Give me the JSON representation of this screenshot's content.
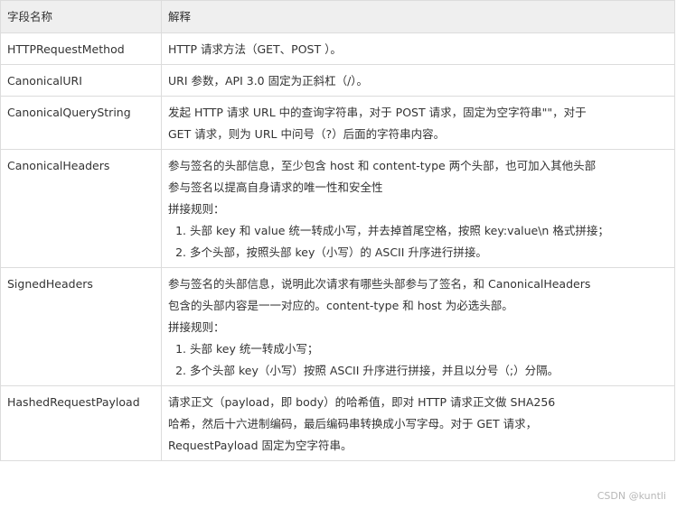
{
  "table": {
    "headers": [
      "字段名称",
      "解释"
    ],
    "rows": [
      {
        "name": "HTTPRequestMethod",
        "desc": [
          "HTTP 请求方法（GET、POST ）。"
        ]
      },
      {
        "name": "CanonicalURI",
        "desc": [
          "URI 参数，API 3.0 固定为正斜杠（/）。"
        ]
      },
      {
        "name": "CanonicalQueryString",
        "desc": [
          "发起 HTTP 请求 URL 中的查询字符串，对于 POST 请求，固定为空字符串\"\"，对于",
          "GET 请求，则为 URL 中问号（?）后面的字符串内容。"
        ]
      },
      {
        "name": "CanonicalHeaders",
        "desc": [
          "参与签名的头部信息，至少包含 host 和 content-type 两个头部，也可加入其他头部",
          "参与签名以提高自身请求的唯一性和安全性"
        ],
        "rule_title": "拼接规则：",
        "rules": [
          "头部 key 和 value 统一转成小写，并去掉首尾空格，按照 key:value\\n 格式拼接；",
          "多个头部，按照头部 key（小写）的 ASCII 升序进行拼接。"
        ]
      },
      {
        "name": "SignedHeaders",
        "desc": [
          "参与签名的头部信息，说明此次请求有哪些头部参与了签名，和 CanonicalHeaders",
          "包含的头部内容是一一对应的。content-type 和 host 为必选头部。"
        ],
        "rule_title": "拼接规则：",
        "rules": [
          "头部 key 统一转成小写；",
          "多个头部 key（小写）按照 ASCII 升序进行拼接，并且以分号（;）分隔。"
        ]
      },
      {
        "name": "HashedRequestPayload",
        "desc": [
          "请求正文（payload，即 body）的哈希值，即对 HTTP 请求正文做 SHA256",
          "哈希，然后十六进制编码，最后编码串转换成小写字母。对于 GET 请求，",
          "RequestPayload 固定为空字符串。"
        ]
      }
    ]
  },
  "watermark": "CSDN @kuntli"
}
